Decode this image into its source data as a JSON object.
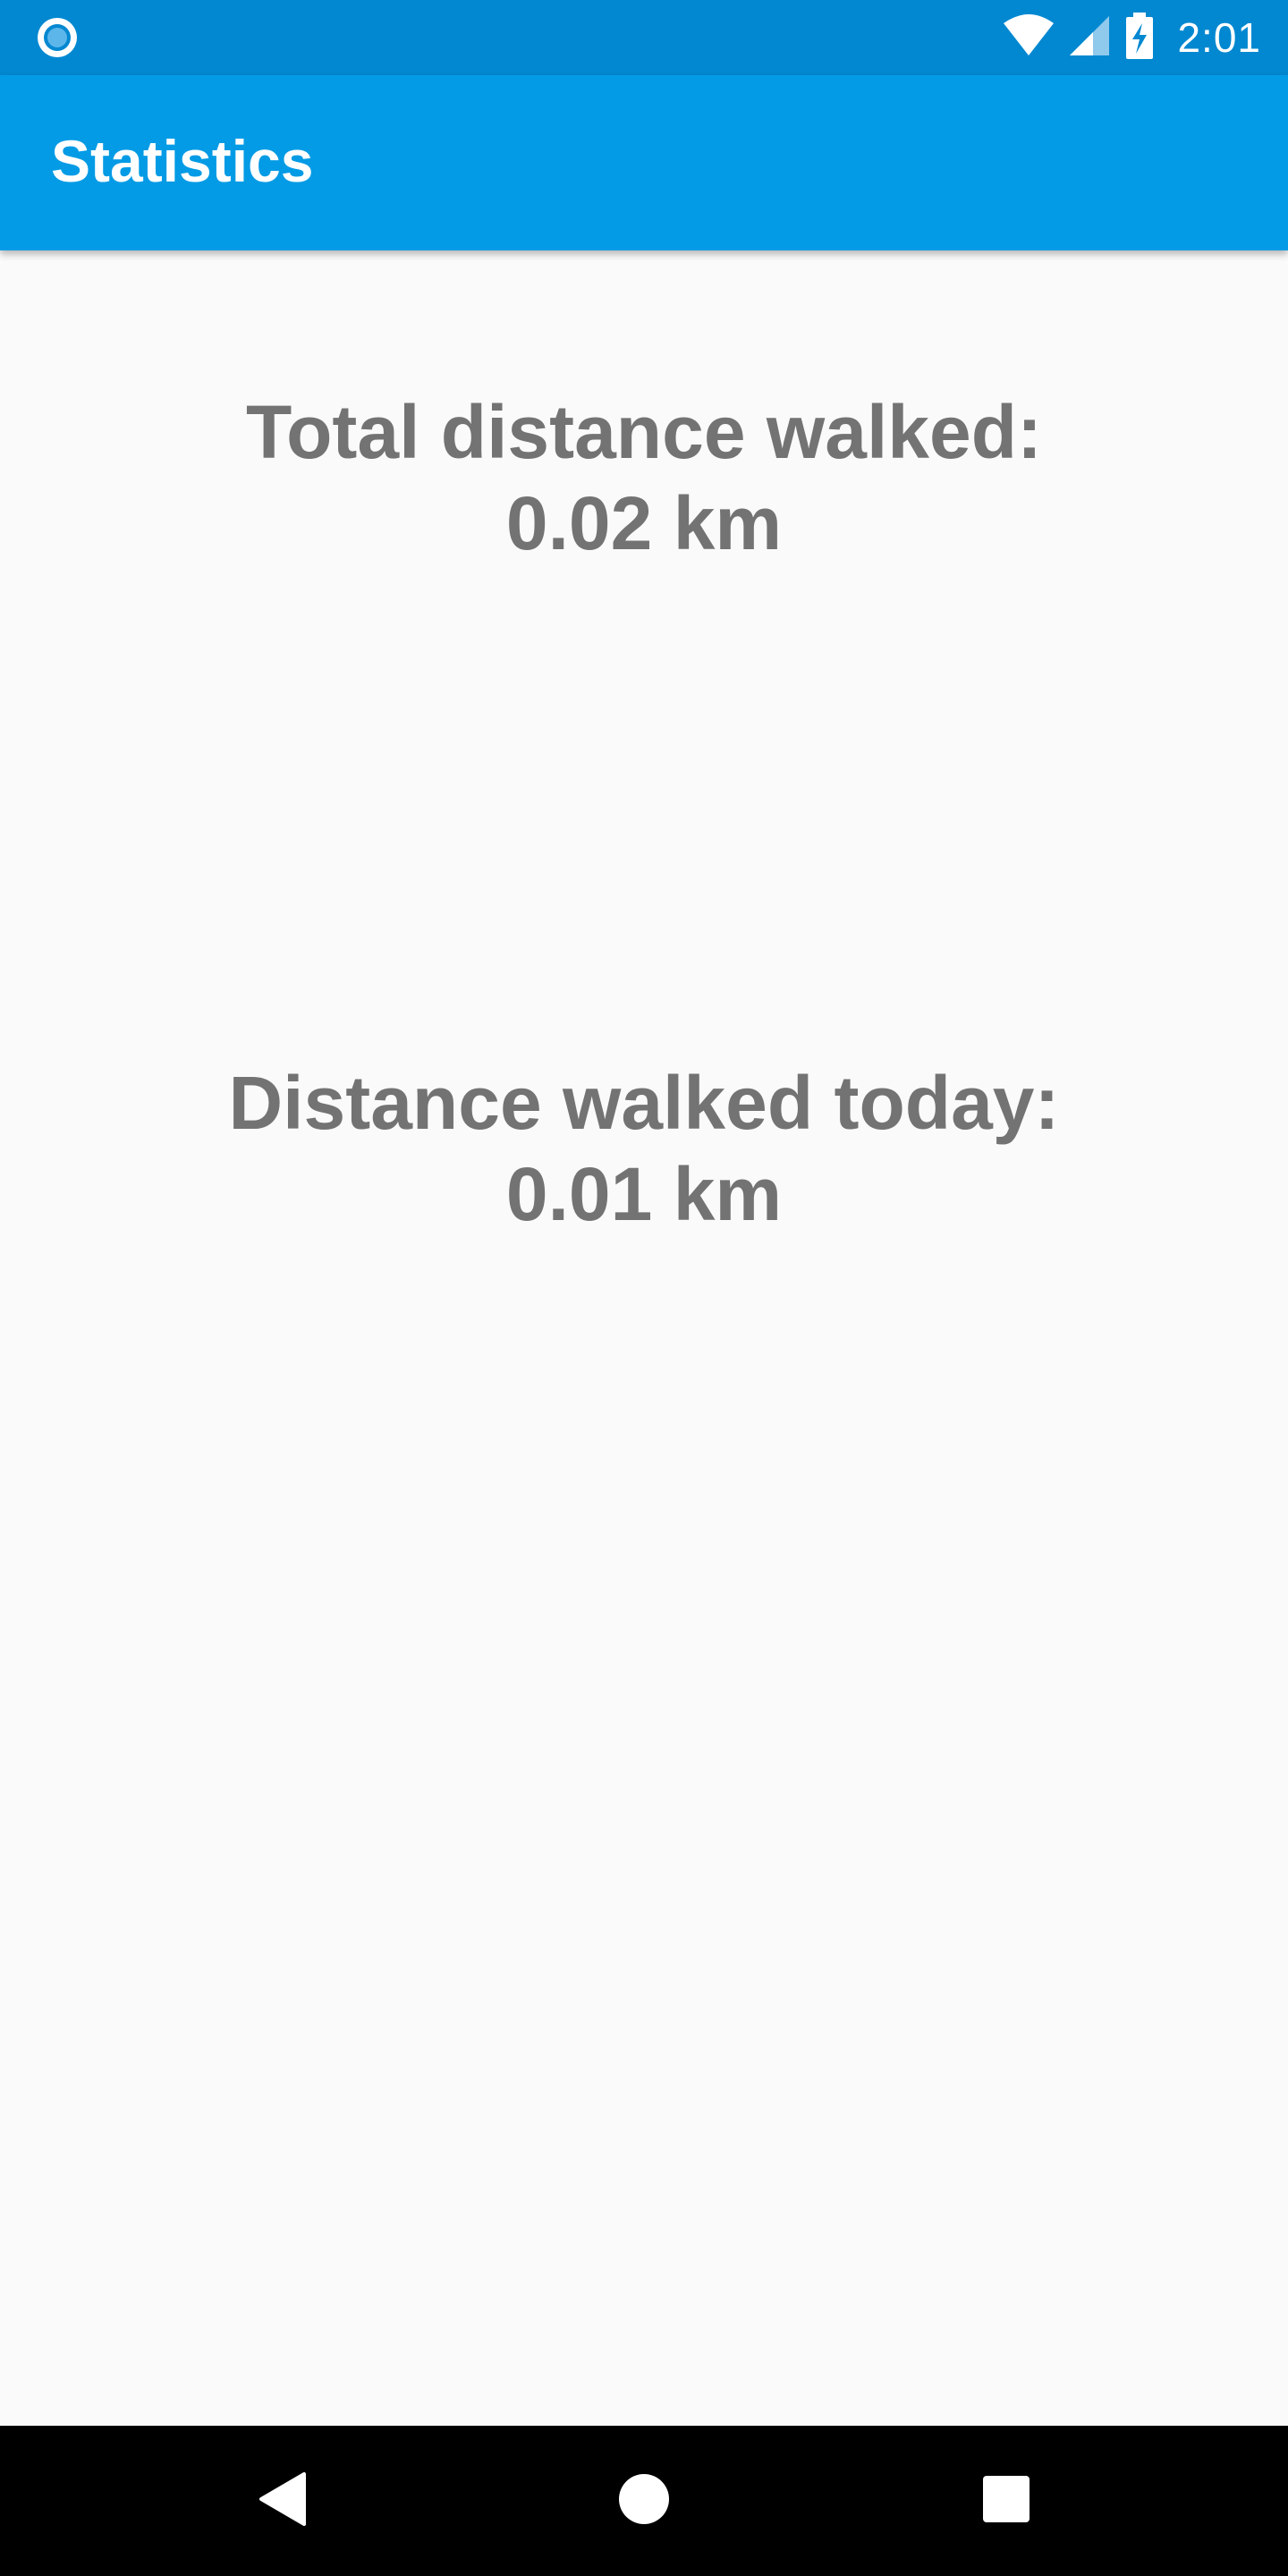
{
  "status_bar": {
    "time": "2:01",
    "notification_icon": "record-icon",
    "wifi_icon": "wifi-icon",
    "signal_icon": "cell-signal-icon",
    "battery_icon": "battery-charging-icon",
    "color": "#0288d1"
  },
  "app_bar": {
    "title": "Statistics",
    "color": "#039be5"
  },
  "stats": {
    "total": {
      "label": "Total distance walked:",
      "value": "0.02 km"
    },
    "today": {
      "label": "Distance walked today:",
      "value": "0.01 km"
    },
    "text_color": "#737373"
  },
  "nav_bar": {
    "back_icon": "back-triangle-icon",
    "home_icon": "home-circle-icon",
    "recents_icon": "recents-square-icon"
  }
}
